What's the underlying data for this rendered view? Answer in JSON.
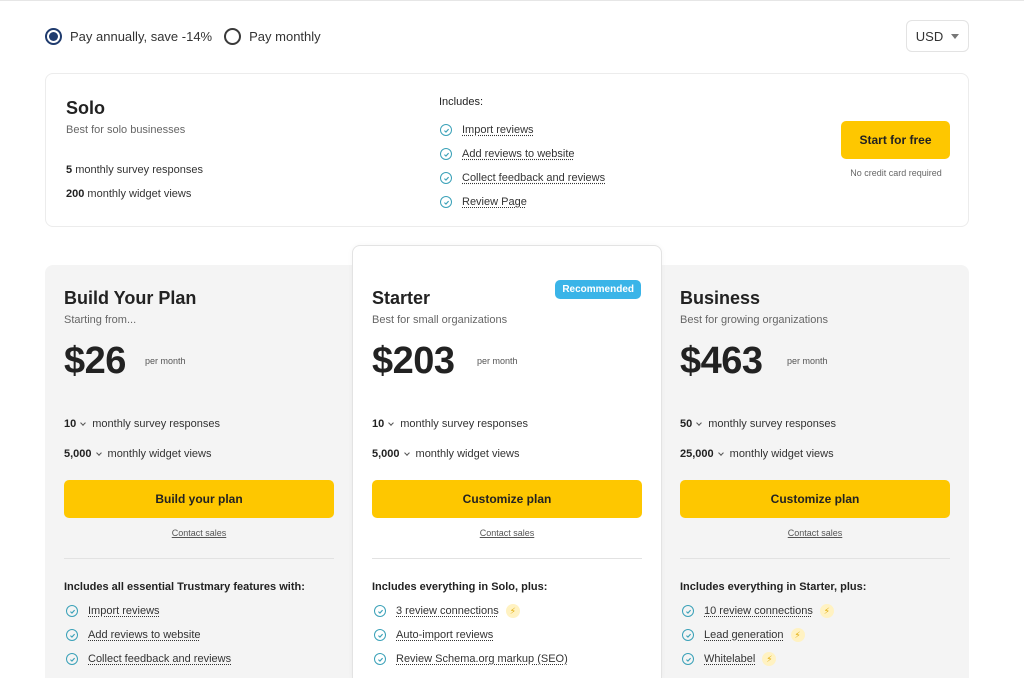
{
  "billing": {
    "annual_label": "Pay annually, save -14%",
    "monthly_label": "Pay monthly",
    "selected": "annual"
  },
  "currency": {
    "value": "USD"
  },
  "solo": {
    "name": "Solo",
    "subtitle": "Best for solo businesses",
    "limits": [
      {
        "value": "5",
        "label": "monthly survey responses"
      },
      {
        "value": "200",
        "label": "monthly widget views"
      }
    ],
    "includes_label": "Includes:",
    "features": [
      "Import reviews",
      "Add reviews to website",
      "Collect feedback and reviews",
      "Review Page"
    ],
    "cta": "Start for free",
    "note": "No credit card required"
  },
  "plans": [
    {
      "name": "Build Your Plan",
      "subtitle": "Starting from...",
      "price": "$26",
      "period": "per month",
      "responses_value": "10",
      "responses_label": "monthly survey responses",
      "views_value": "5,000",
      "views_label": "monthly widget views",
      "cta": "Build your plan",
      "contact": "Contact sales",
      "includes_label": "Includes all essential Trustmary features with:",
      "features": [
        {
          "text": "Import reviews",
          "premium": false
        },
        {
          "text": "Add reviews to website",
          "premium": false
        },
        {
          "text": "Collect feedback and reviews",
          "premium": false
        }
      ]
    },
    {
      "name": "Starter",
      "badge": "Recommended",
      "subtitle": "Best for small organizations",
      "price": "$203",
      "period": "per month",
      "responses_value": "10",
      "responses_label": "monthly survey responses",
      "views_value": "5,000",
      "views_label": "monthly widget views",
      "cta": "Customize plan",
      "contact": "Contact sales",
      "includes_label": "Includes everything in Solo, plus:",
      "features": [
        {
          "text": "3 review connections",
          "premium": true
        },
        {
          "text": "Auto-import reviews",
          "premium": false
        },
        {
          "text": "Review Schema.org markup (SEO)",
          "premium": false
        }
      ]
    },
    {
      "name": "Business",
      "subtitle": "Best for growing organizations",
      "price": "$463",
      "period": "per month",
      "responses_value": "50",
      "responses_label": "monthly survey responses",
      "views_value": "25,000",
      "views_label": "monthly widget views",
      "cta": "Customize plan",
      "contact": "Contact sales",
      "includes_label": "Includes everything in Starter, plus:",
      "features": [
        {
          "text": "10 review connections",
          "premium": true
        },
        {
          "text": "Lead generation",
          "premium": true
        },
        {
          "text": "Whitelabel",
          "premium": true
        }
      ]
    }
  ],
  "icons": {
    "check": "check-circle-icon",
    "premium": "lightning-bolt-icon",
    "dropdown": "chevron-down-icon"
  },
  "colors": {
    "accent": "#fec700",
    "badge": "#3ab4e8",
    "check": "#3aa1b8",
    "radio": "#1f3b6e"
  }
}
